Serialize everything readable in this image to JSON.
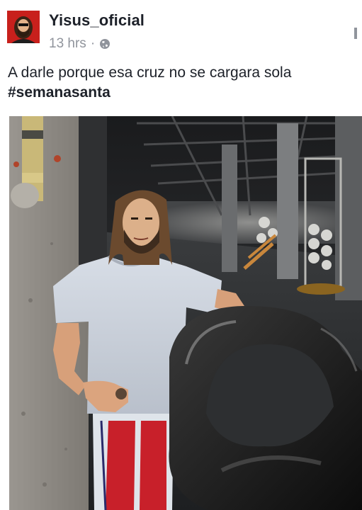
{
  "post": {
    "author": "Yisus_oficial",
    "time": "13 hrs",
    "separator": "·",
    "privacy_icon": "globe-icon",
    "text": "A darle porque esa cruz no se cargara sola",
    "hashtag": "#semanasanta",
    "menu_icon": "chevron-icon",
    "avatar_icon": "avatar-icon"
  },
  "colors": {
    "author": "#1d2129",
    "meta": "#90949c",
    "avatar_bg": "#c8201c"
  }
}
